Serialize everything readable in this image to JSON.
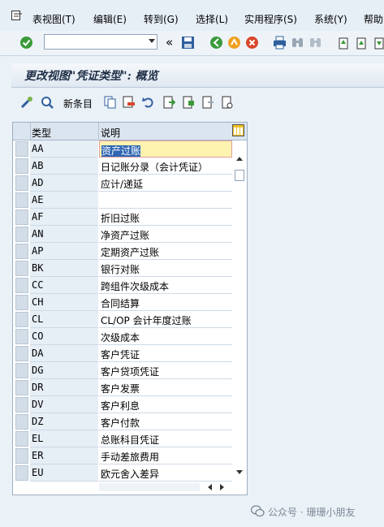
{
  "menubar": {
    "items": [
      "表视图(T)",
      "编辑(E)",
      "转到(G)",
      "选择(L)",
      "实用程序(S)",
      "系统(Y)",
      "帮助"
    ]
  },
  "toolbar": {
    "command_value": "",
    "back_symbol": "«"
  },
  "screen": {
    "title": "更改视图\"凭证类型\": 概览"
  },
  "app_toolbar": {
    "new_entries_label": "新条目"
  },
  "table": {
    "col_type": "类型",
    "col_desc": "说明",
    "rows": [
      {
        "code": "AA",
        "desc": "资产过账"
      },
      {
        "code": "AB",
        "desc": "日记账分录（会计凭证）"
      },
      {
        "code": "AD",
        "desc": "应计/递延"
      },
      {
        "code": "AE",
        "desc": ""
      },
      {
        "code": "AF",
        "desc": "折旧过账"
      },
      {
        "code": "AN",
        "desc": "净资产过账"
      },
      {
        "code": "AP",
        "desc": "定期资产过账"
      },
      {
        "code": "BK",
        "desc": "银行对账"
      },
      {
        "code": "CC",
        "desc": "跨组件次级成本"
      },
      {
        "code": "CH",
        "desc": "合同结算"
      },
      {
        "code": "CL",
        "desc": "CL/OP 会计年度过账"
      },
      {
        "code": "CO",
        "desc": "次级成本"
      },
      {
        "code": "DA",
        "desc": "客户凭证"
      },
      {
        "code": "DG",
        "desc": "客户贷项凭证"
      },
      {
        "code": "DR",
        "desc": "客户发票"
      },
      {
        "code": "DV",
        "desc": "客户利息"
      },
      {
        "code": "DZ",
        "desc": "客户付款"
      },
      {
        "code": "EL",
        "desc": "总账科目凭证"
      },
      {
        "code": "ER",
        "desc": "手动差旅费用"
      },
      {
        "code": "EU",
        "desc": "欧元舍入差异"
      }
    ]
  },
  "watermark": {
    "text": "公众号 · 珊珊小朋友"
  }
}
